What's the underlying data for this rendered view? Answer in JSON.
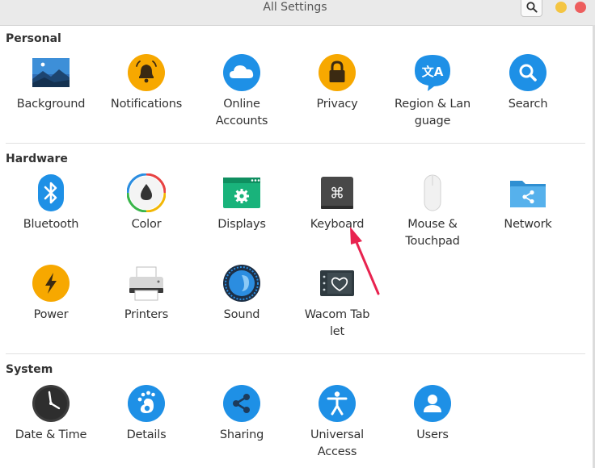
{
  "window": {
    "title": "All Settings"
  },
  "sections": {
    "personal": {
      "title": "Personal",
      "items": [
        {
          "label": "Background"
        },
        {
          "label": "Notifications"
        },
        {
          "label": "Online\nAccounts"
        },
        {
          "label": "Privacy"
        },
        {
          "label": "Region & Lan\nguage",
          "glyph": "文A"
        },
        {
          "label": "Search"
        }
      ]
    },
    "hardware": {
      "title": "Hardware",
      "items": [
        {
          "label": "Bluetooth"
        },
        {
          "label": "Color"
        },
        {
          "label": "Displays"
        },
        {
          "label": "Keyboard",
          "glyph": "⌘"
        },
        {
          "label": "Mouse &\nTouchpad"
        },
        {
          "label": "Network"
        },
        {
          "label": "Power"
        },
        {
          "label": "Printers"
        },
        {
          "label": "Sound"
        },
        {
          "label": "Wacom Tab\nlet"
        }
      ]
    },
    "system": {
      "title": "System",
      "items": [
        {
          "label": "Date & Time"
        },
        {
          "label": "Details"
        },
        {
          "label": "Sharing"
        },
        {
          "label": "Universal\nAccess"
        },
        {
          "label": "Users"
        }
      ]
    }
  },
  "colors": {
    "accent_blue": "#1e90e6",
    "accent_yellow": "#f7a800",
    "annotation_arrow": "#e8234f"
  }
}
